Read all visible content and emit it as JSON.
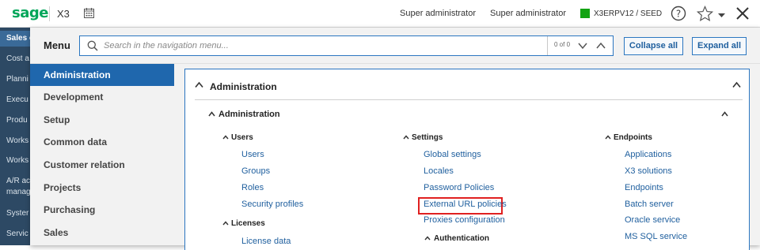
{
  "topbar": {
    "logo": "sage",
    "product": "X3",
    "user_1": "Super administrator",
    "user_2": "Super administrator",
    "folder": "X3ERPV12 / SEED",
    "folder_color": "#12a312",
    "icons": [
      "calendar-icon",
      "help-icon",
      "star-icon",
      "chevron-down-icon",
      "close-icon"
    ]
  },
  "background_nav": {
    "items": [
      "Sales c",
      "Cost a",
      "Planni",
      "Execu",
      "Produ",
      "Works",
      "Works",
      "A/R ac",
      "manag",
      "Syster",
      "Servic"
    ]
  },
  "menu": {
    "title": "Menu",
    "search": {
      "placeholder": "Search in the navigation menu...",
      "value": "",
      "count": "0 of 0"
    },
    "collapse_all": "Collapse all",
    "expand_all": "Expand all"
  },
  "nav": {
    "items": [
      {
        "label": "Administration",
        "active": true
      },
      {
        "label": "Development",
        "active": false
      },
      {
        "label": "Setup",
        "active": false
      },
      {
        "label": "Common data",
        "active": false
      },
      {
        "label": "Customer relation",
        "active": false
      },
      {
        "label": "Projects",
        "active": false
      },
      {
        "label": "Purchasing",
        "active": false
      },
      {
        "label": "Sales",
        "active": false
      }
    ]
  },
  "content": {
    "section_title": "Administration",
    "subsection_title": "Administration",
    "groups": {
      "users": {
        "title": "Users",
        "links": [
          "Users",
          "Groups",
          "Roles",
          "Security profiles"
        ]
      },
      "licenses": {
        "title": "Licenses",
        "links": [
          "License data"
        ]
      },
      "settings": {
        "title": "Settings",
        "links": [
          "Global settings",
          "Locales",
          "Password Policies",
          "External URL policies",
          "Proxies configuration"
        ]
      },
      "authentication": {
        "title": "Authentication"
      },
      "endpoints": {
        "title": "Endpoints",
        "links": [
          "Applications",
          "X3 solutions",
          "Endpoints",
          "Batch server",
          "Oracle service",
          "MS SQL service"
        ]
      }
    },
    "highlight_color": "#e02020",
    "accent_color": "#1f67ad"
  }
}
